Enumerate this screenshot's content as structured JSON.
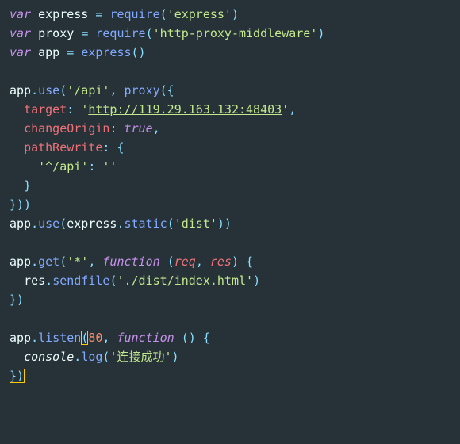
{
  "code": {
    "line1": {
      "kw": "var",
      "name": "express",
      "eq": "=",
      "call": "require",
      "open": "(",
      "str": "'express'",
      "close": ")"
    },
    "line2": {
      "kw": "var",
      "name": "proxy",
      "eq": "=",
      "call": "require",
      "open": "(",
      "str": "'http-proxy-middleware'",
      "close": ")"
    },
    "line3": {
      "kw": "var",
      "name": "app",
      "eq": "=",
      "call": "express",
      "parens": "()"
    },
    "line5": {
      "obj": "app",
      "dot": ".",
      "method": "use",
      "open": "(",
      "arg": "'/api'",
      "comma": ",",
      "call2": "proxy",
      "open2": "({"
    },
    "line6": {
      "prop": "target",
      "colon": ":",
      "q1": "'",
      "url": "http://119.29.163.132:48403",
      "q2": "'",
      "comma": ","
    },
    "line7": {
      "prop": "changeOrigin",
      "colon": ":",
      "val": "true",
      "comma": ","
    },
    "line8": {
      "prop": "pathRewrite",
      "colon": ":",
      "open": "{"
    },
    "line9": {
      "key": "'^/api'",
      "colon": ":",
      "val": "''"
    },
    "line10": {
      "close": "}"
    },
    "line11": {
      "close": "}))"
    },
    "line12": {
      "obj": "app",
      "dot": ".",
      "method": "use",
      "open": "(",
      "call": "express",
      "dot2": ".",
      "method2": "static",
      "open2": "(",
      "str": "'dist'",
      "close": "))"
    },
    "line14": {
      "obj": "app",
      "dot": ".",
      "method": "get",
      "open": "(",
      "str": "'*'",
      "comma": ",",
      "kw": "function",
      "open2": "(",
      "p1": "req",
      "comma2": ",",
      "p2": "res",
      "close2": ")",
      "brace": "{"
    },
    "line15": {
      "obj": "res",
      "dot": ".",
      "method": "sendfile",
      "open": "(",
      "str": "'./dist/index.html'",
      "close": ")"
    },
    "line16": {
      "close": "})"
    },
    "line18": {
      "obj": "app",
      "dot": ".",
      "method": "listen",
      "open": "(",
      "num": "80",
      "comma": ",",
      "kw": "function",
      "parens": "()",
      "brace": "{"
    },
    "line19": {
      "obj": "console",
      "dot": ".",
      "method": "log",
      "open": "(",
      "str": "'连接成功'",
      "close": ")"
    },
    "line20": {
      "close": "})"
    }
  }
}
